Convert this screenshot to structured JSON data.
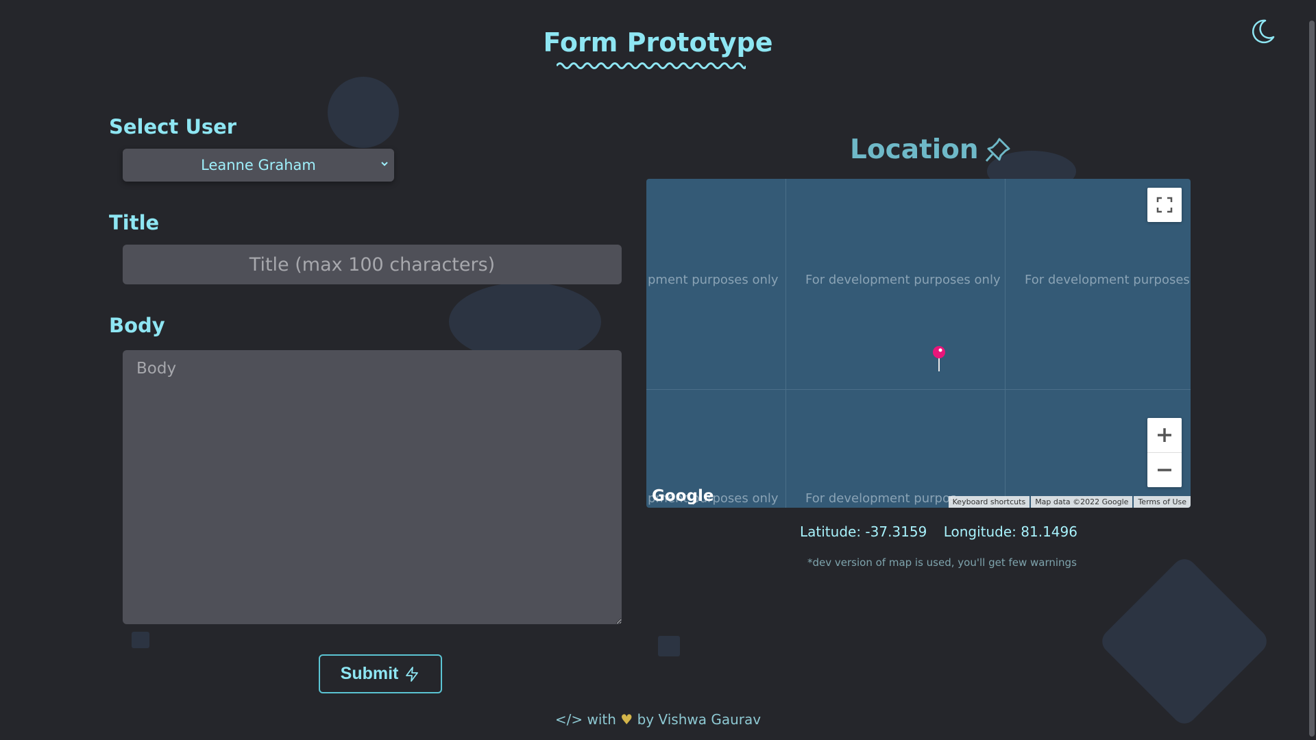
{
  "header": {
    "title": "Form Prototype",
    "theme_toggle_icon": "moon-icon"
  },
  "form": {
    "user_label": "Select User",
    "user_selected": "Leanne Graham",
    "title_label": "Title",
    "title_placeholder": "Title (max 100 characters)",
    "body_label": "Body",
    "body_placeholder": "Body",
    "submit_label": "Submit",
    "submit_icon": "lightning-icon"
  },
  "location": {
    "title": "Location",
    "title_icon": "pin-icon",
    "map": {
      "watermark": "For development purposes only",
      "watermark_clipped_left": "pment purposes only",
      "watermark_clipped_right": "For development purposes o",
      "watermark_bottom_left": "pment purposes only",
      "watermark_bottom_mid": "For development purpos",
      "logo": "Google",
      "attribution": [
        "Keyboard shortcuts",
        "Map data ©2022 Google",
        "Terms of Use"
      ],
      "marker_color": "#e8167a"
    },
    "latitude": "Latitude: -37.3159",
    "longitude": "Longitude: 81.1496",
    "note": "*dev version of map is used, you'll get few warnings"
  },
  "footer": {
    "prefix": "</> with",
    "heart": "♥",
    "suffix": "by Vishwa Gaurav"
  },
  "colors": {
    "background": "#25262b",
    "accent": "#8ee6f3",
    "field": "#4f5058",
    "map": "#345a76"
  }
}
